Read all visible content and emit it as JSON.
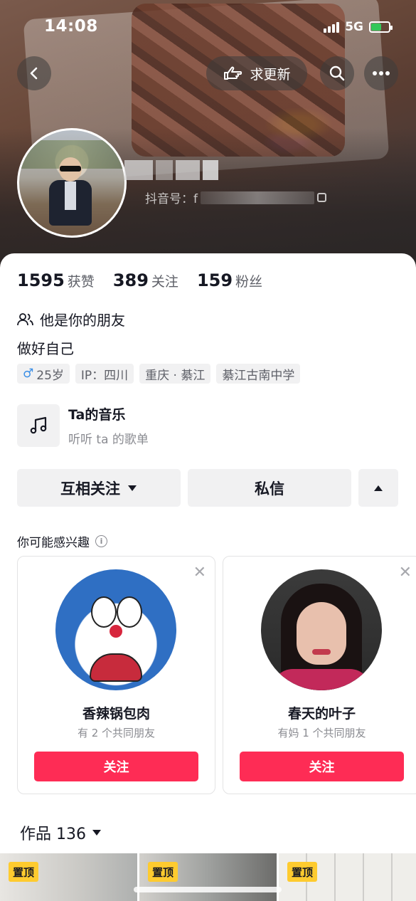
{
  "status_bar": {
    "time": "14:08",
    "network": "5G"
  },
  "header": {
    "update_label": "求更新",
    "douyin_id_prefix": "抖音号：f"
  },
  "stats": [
    {
      "num": "1595",
      "label": "获赞"
    },
    {
      "num": "389",
      "label": "关注"
    },
    {
      "num": "159",
      "label": "粉丝"
    }
  ],
  "profile": {
    "friend_label": "他是你的朋友",
    "bio": "做好自己",
    "tags": {
      "age": "25岁",
      "ip": "IP：四川",
      "location": "重庆 · 綦江",
      "school": "綦江古南中学"
    }
  },
  "music": {
    "title": "Ta的音乐",
    "subtitle": "听听 ta 的歌单"
  },
  "actions": {
    "mutual_follow": "互相关注",
    "message": "私信"
  },
  "interest": {
    "title": "你可能感兴趣",
    "cards": [
      {
        "name": "香辣锅包肉",
        "mutual": "有 2 个共同朋友",
        "follow": "关注"
      },
      {
        "name": "春天的叶子",
        "mutual": "有妈 1 个共同朋友",
        "follow": "关注"
      }
    ]
  },
  "works": {
    "label": "作品 136",
    "pin_label": "置顶"
  },
  "colors": {
    "accent": "#fe2c55",
    "pin": "#fecb2f"
  }
}
